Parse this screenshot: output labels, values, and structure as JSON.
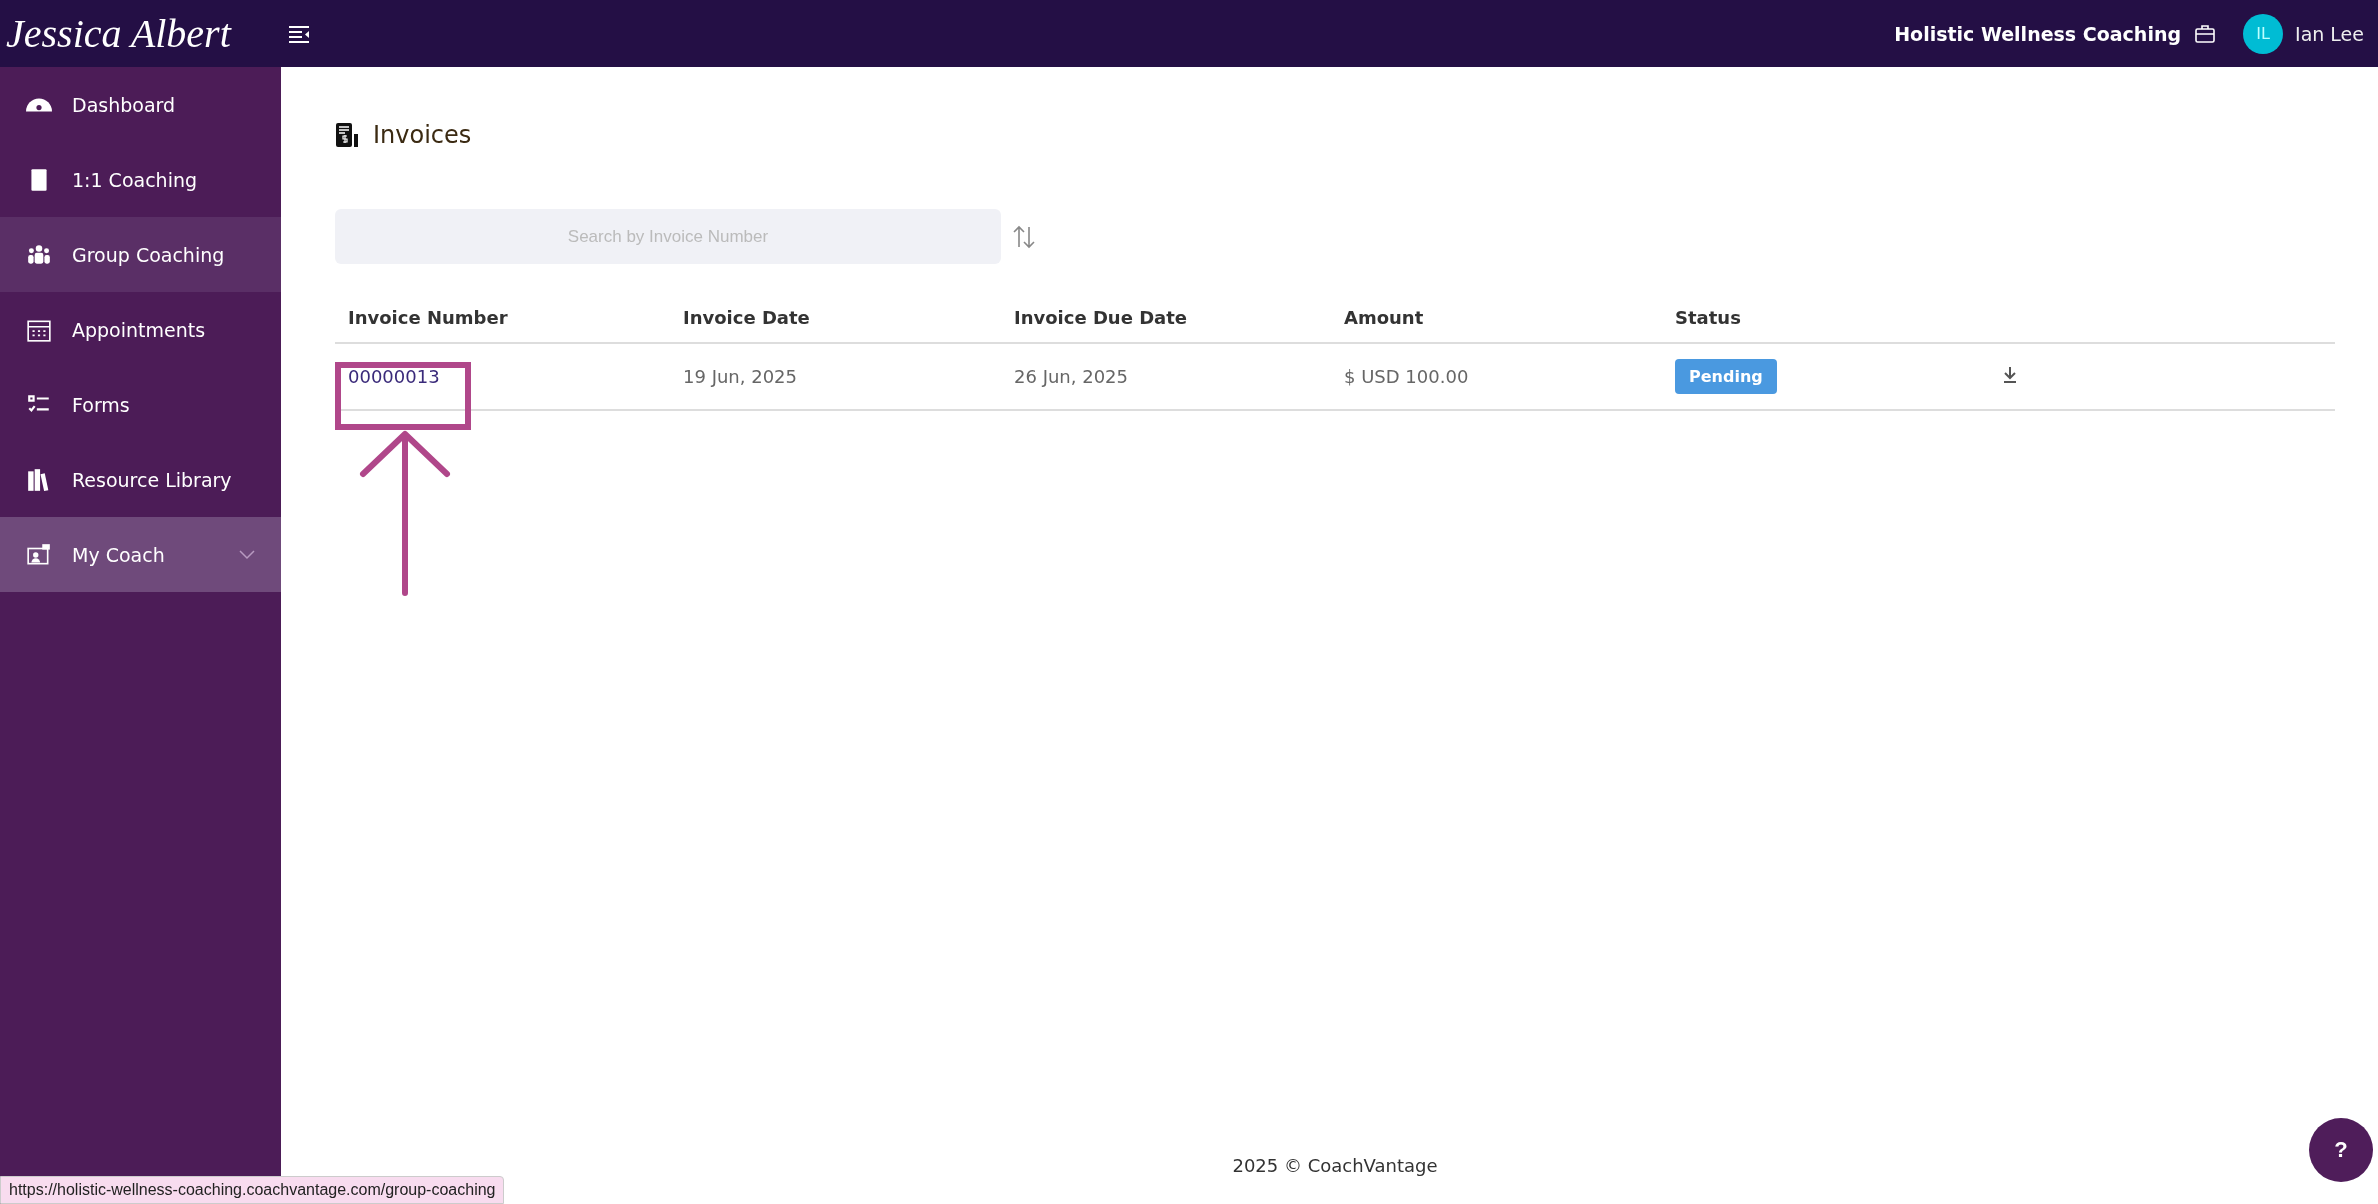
{
  "header": {
    "logo": "Jessica Albert",
    "business": "Holistic Wellness Coaching",
    "user": {
      "initials": "IL",
      "name": "Ian Lee"
    }
  },
  "sidebar": {
    "items": [
      {
        "label": "Dashboard",
        "selected": false,
        "hovered": false
      },
      {
        "label": "1:1 Coaching",
        "selected": false,
        "hovered": false
      },
      {
        "label": "Group Coaching",
        "selected": false,
        "hovered": true
      },
      {
        "label": "Appointments",
        "selected": false,
        "hovered": false
      },
      {
        "label": "Forms",
        "selected": false,
        "hovered": false
      },
      {
        "label": "Resource Library",
        "selected": false,
        "hovered": false
      },
      {
        "label": "My Coach",
        "selected": true,
        "hovered": false,
        "expanded": false
      }
    ]
  },
  "page": {
    "title": "Invoices",
    "search": {
      "placeholder": "Search by Invoice Number"
    },
    "table": {
      "columns": [
        "Invoice Number",
        "Invoice Date",
        "Invoice Due Date",
        "Amount",
        "Status"
      ],
      "rows": [
        {
          "number": "00000013",
          "date": "19 Jun, 2025",
          "due": "26 Jun, 2025",
          "amount": "$ USD 100.00",
          "status": "Pending",
          "annotated": true
        }
      ]
    }
  },
  "footer": "2025 © CoachVantage",
  "help": "?",
  "status_url": "https://holistic-wellness-coaching.coachvantage.com/group-coaching"
}
